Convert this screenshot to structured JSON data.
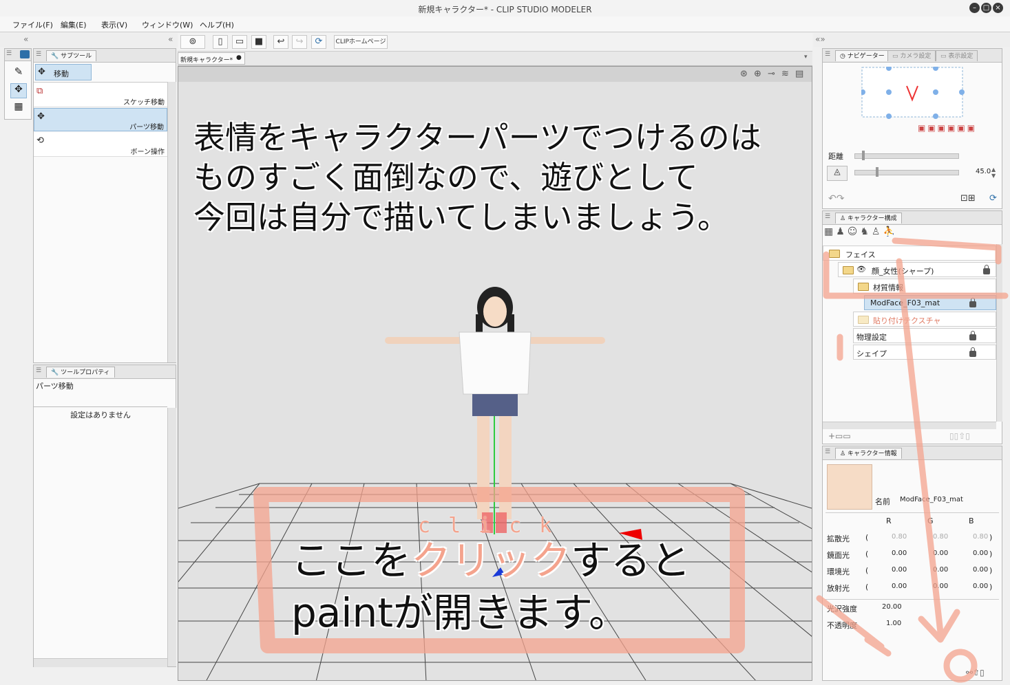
{
  "window": {
    "title": "新規キャラクター* - CLIP STUDIO MODELER"
  },
  "menu": [
    "ファイル(F)",
    "編集(E)",
    "表示(V)",
    "ウィンドウ(W)",
    "ヘルプ(H)"
  ],
  "toolbar": {
    "home_label": "CLIPホームページ"
  },
  "document_tab": "新規キャラクター*",
  "subtool": {
    "tab_label": "サブツール",
    "group_label": "移動",
    "items": [
      "スケッチ移動",
      "パーツ移動",
      "ボーン操作"
    ]
  },
  "tool_property": {
    "tab_label": "ツールプロパティ",
    "title": "パーツ移動",
    "empty_message": "設定はありません"
  },
  "navigator": {
    "tabs": [
      "ナビゲーター",
      "カメラ設定",
      "表示設定"
    ],
    "distance_label": "距離",
    "fov_value": "45.0"
  },
  "character_structure": {
    "tab_label": "キャラクター構成",
    "tree": [
      {
        "label": "フェイス"
      },
      {
        "label": "顔_女性(シャープ)"
      },
      {
        "label": "材質情報"
      },
      {
        "label": "ModFace_F03_mat"
      },
      {
        "label": "貼り付けテクスチャ"
      },
      {
        "label": "物理設定"
      },
      {
        "label": "シェイプ"
      }
    ]
  },
  "character_info": {
    "tab_label": "キャラクター情報",
    "name_label": "名前",
    "name_value": "ModFace_F03_mat",
    "columns": [
      "R",
      "G",
      "B"
    ],
    "rows": [
      {
        "label": "拡散光",
        "r": "0.80",
        "g": "0.80",
        "b": "0.80"
      },
      {
        "label": "鏡面光",
        "r": "0.00",
        "g": "0.00",
        "b": "0.00"
      },
      {
        "label": "環境光",
        "r": "0.00",
        "g": "0.00",
        "b": "0.00"
      },
      {
        "label": "放射光",
        "r": "0.00",
        "g": "0.00",
        "b": "0.00"
      }
    ],
    "gloss_label": "光沢強度",
    "gloss_value": "20.00",
    "opacity_label": "不透明度",
    "opacity_value": "1.00"
  },
  "annotations": {
    "top_lines": [
      "表情をキャラクターパーツでつけるのは",
      "ものすごく面倒なので、遊びとして",
      "今回は自分で描いてしまいましょう。"
    ],
    "click_letters": [
      "c",
      "l",
      "i",
      "c",
      "k"
    ],
    "bottom_line1_pre": "ここを",
    "bottom_line1_highlight": "クリック",
    "bottom_line1_post": "すると",
    "bottom_line2": "paintが開きます。"
  },
  "colors": {
    "accent_highlight": "#cfe3f3",
    "annotation_salmon": "#f4a38d",
    "viewport_bg": "#e2e2e2"
  }
}
